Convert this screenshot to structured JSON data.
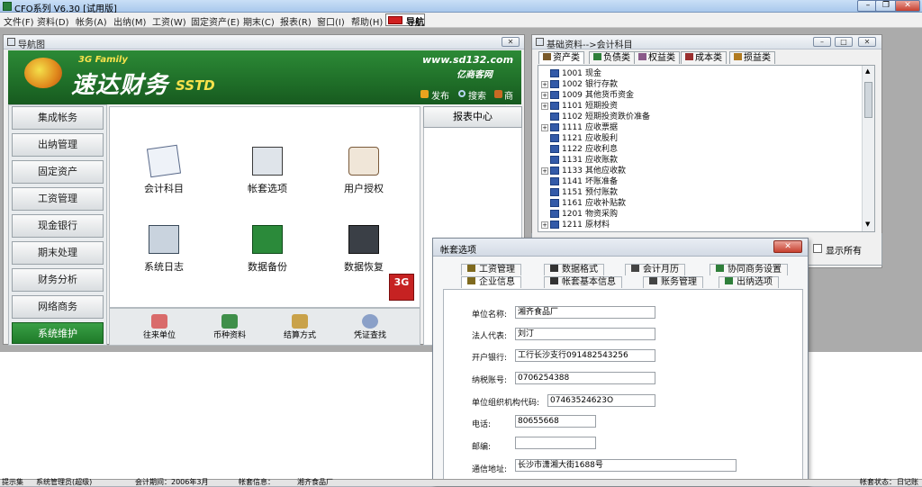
{
  "app": {
    "title": "CFO系列 V6.30 [试用版]"
  },
  "menu": [
    "文件(F)",
    "资料(D)",
    "帐务(A)",
    "出纳(M)",
    "工资(W)",
    "固定资产(E)",
    "期末(C)",
    "报表(R)",
    "窗口(I)",
    "帮助(H)"
  ],
  "menu_nav_label": "导航",
  "nav_window": {
    "title": "导航图",
    "brand_family": "3G Family",
    "brand_name": "速达财务",
    "brand_sstd": "SSTD",
    "url": "www.sd132.com",
    "slogan": "亿商客网",
    "links": [
      "发布",
      "搜索",
      "商机"
    ],
    "left_buttons": [
      "集成帐务",
      "出纳管理",
      "固定资产",
      "工资管理",
      "现金银行",
      "期末处理",
      "财务分析",
      "网络商务",
      "系统维护"
    ],
    "icons": [
      "会计科目",
      "帐套选项",
      "用户授权",
      "系统日志",
      "数据备份",
      "数据恢复"
    ],
    "bottom_icons": [
      "往来单位",
      "币种资料",
      "结算方式",
      "凭证查找"
    ],
    "report_center": "报表中心"
  },
  "accounts_window": {
    "title": "基础资料-->会计科目",
    "tabs": [
      "资产类",
      "负债类",
      "权益类",
      "成本类",
      "损益类"
    ],
    "rows": [
      {
        "code": "1001",
        "name": "现金",
        "expand": false
      },
      {
        "code": "1002",
        "name": "银行存款",
        "expand": true
      },
      {
        "code": "1009",
        "name": "其他货币资金",
        "expand": true
      },
      {
        "code": "1101",
        "name": "短期投资",
        "expand": true
      },
      {
        "code": "1102",
        "name": "短期投资跌价准备",
        "expand": false
      },
      {
        "code": "1111",
        "name": "应收票据",
        "expand": true
      },
      {
        "code": "1121",
        "name": "应收股利",
        "expand": false
      },
      {
        "code": "1122",
        "name": "应收利息",
        "expand": false
      },
      {
        "code": "1131",
        "name": "应收账款",
        "expand": false
      },
      {
        "code": "1133",
        "name": "其他应收款",
        "expand": true
      },
      {
        "code": "1141",
        "name": "坏账准备",
        "expand": false
      },
      {
        "code": "1151",
        "name": "预付账款",
        "expand": false
      },
      {
        "code": "1161",
        "name": "应收补贴款",
        "expand": false
      },
      {
        "code": "1201",
        "name": "物资采购",
        "expand": false
      },
      {
        "code": "1211",
        "name": "原材料",
        "expand": true
      }
    ],
    "show_all": "显示所有"
  },
  "dialog": {
    "title": "帐套选项",
    "tabs_row1": [
      "工资管理",
      "数据格式",
      "会计月历",
      "协同商务设置"
    ],
    "tabs_row2": [
      "企业信息",
      "帐套基本信息",
      "账务管理",
      "出纳选项"
    ],
    "fields": [
      {
        "label": "单位名称:",
        "value": "湘齐食品厂"
      },
      {
        "label": "法人代表:",
        "value": "刘汀"
      },
      {
        "label": "开户银行:",
        "value": "工行长沙支行091482543256"
      },
      {
        "label": "纳税账号:",
        "value": "0706254388"
      },
      {
        "label": "单位组织机构代码:",
        "value": "07463524623O"
      },
      {
        "label": "电话:",
        "value": "80655668"
      },
      {
        "label": "邮编:",
        "value": ""
      },
      {
        "label": "通信地址:",
        "value": "长沙市潇湘大街1688号"
      }
    ]
  },
  "statusbar": [
    "提示集",
    "系统管理员(超级)",
    "会计期间：2006年3月",
    "帐套信息：",
    "湘齐食品厂",
    "帐套状态：",
    "日记账"
  ]
}
